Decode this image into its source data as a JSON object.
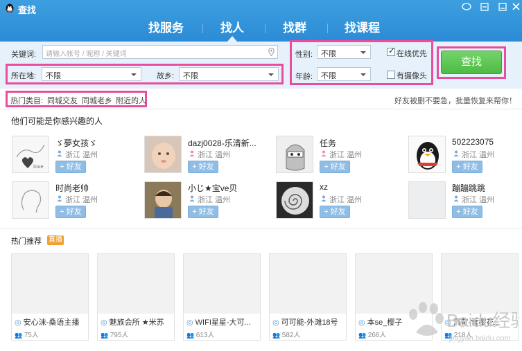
{
  "window": {
    "title": "查找",
    "logo": "qq-penguin-logo",
    "controls": [
      "chat-bubble-icon",
      "minimize-icon",
      "close-icon"
    ]
  },
  "tabs": [
    {
      "label": "找服务",
      "active": false
    },
    {
      "label": "找人",
      "active": true
    },
    {
      "label": "找群",
      "active": false
    },
    {
      "label": "找课程",
      "active": false
    }
  ],
  "search": {
    "keyword_label": "关键词:",
    "keyword_placeholder": "请输入帐号 / 昵称 / 关键词",
    "location_label": "所在地:",
    "location_value": "不限",
    "hometown_label": "故乡:",
    "hometown_value": "不限",
    "gender_label": "性别:",
    "gender_value": "不限",
    "age_label": "年龄:",
    "age_value": "不限",
    "online_first_label": "在线优先",
    "online_first_checked": true,
    "has_camera_label": "有摄像头",
    "has_camera_checked": false,
    "find_button": "查找"
  },
  "hot_categories": {
    "label": "热门类目:",
    "items": [
      "同城交友",
      "同城老乡",
      "附近的人"
    ],
    "slogan": "好友被删不要急，批量恢复来帮你！"
  },
  "people_section": {
    "title": "他们可能是你感兴趣的人",
    "add_label": "+ 好友",
    "people": [
      {
        "name": "ゞ夢女孩ゞ",
        "location": "浙江 温州",
        "gender": "male"
      },
      {
        "name": "dazj0028-乐清新...",
        "location": "浙江 温州",
        "gender": "female"
      },
      {
        "name": "任务",
        "location": "浙江 温州",
        "gender": "female"
      },
      {
        "name": "502223075",
        "location": "浙江 温州",
        "gender": "male"
      },
      {
        "name": "时尚老帅",
        "location": "浙江 温州",
        "gender": "male"
      },
      {
        "name": "小じ★宝ve贝",
        "location": "浙江 温州",
        "gender": "male"
      },
      {
        "name": "xz",
        "location": "浙江 温州",
        "gender": "male"
      },
      {
        "name": "蹦蹦跳跳",
        "location": "浙江 温州",
        "gender": "male"
      }
    ]
  },
  "groups_section": {
    "title": "热门推荐",
    "badge": "直播",
    "groups": [
      {
        "title": "安心沫-桑语主播",
        "count": "75人"
      },
      {
        "title": "魅族会所 ★米苏",
        "count": "795人"
      },
      {
        "title": "WIFI星星-大可...",
        "count": "613人"
      },
      {
        "title": "可可能-外滩18号",
        "count": "582人"
      },
      {
        "title": "本se_樱子",
        "count": "266人"
      },
      {
        "title": "沉苛-雪樱花...",
        "count": "218人"
      }
    ]
  },
  "watermark": {
    "text": "Baidu经验",
    "sub": "jingyan.baidu.com"
  },
  "colors": {
    "header": "#2b8bd6",
    "panel": "#e6f1fb",
    "highlight": "#e84e9c",
    "find_button": "#4dbb43",
    "add_button": "#8fbde6",
    "badge": "#f0a030"
  }
}
